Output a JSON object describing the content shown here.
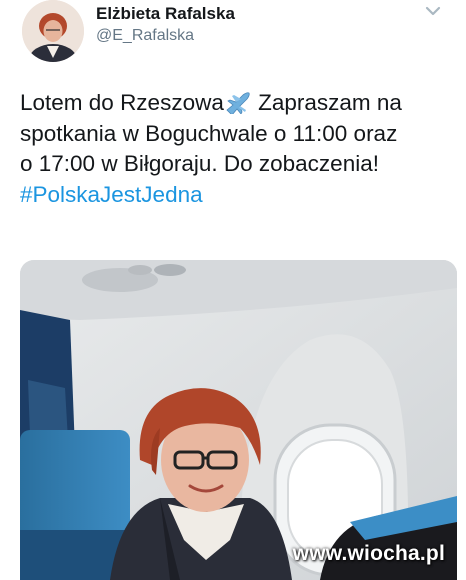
{
  "tweet": {
    "display_name": "Elżbieta Rafalska",
    "handle": "@E_Rafalska",
    "text_lines": [
      "Lotem do Rzeszowa",
      "Zapraszam na",
      "spotkania w Boguchwale o 11:00 oraz",
      "o 17:00 w Biłgoraju. Do zobaczenia!"
    ],
    "hashtag": "#PolskaJestJedna",
    "emoji": "airplane-emoji",
    "menu_icon": "chevron-down-icon"
  },
  "photo": {
    "watermark": "www.wiocha.pl"
  },
  "colors": {
    "text": "#14171a",
    "secondary": "#657786",
    "link": "#1b95e0",
    "seat_blue": "#2f7fb5"
  }
}
